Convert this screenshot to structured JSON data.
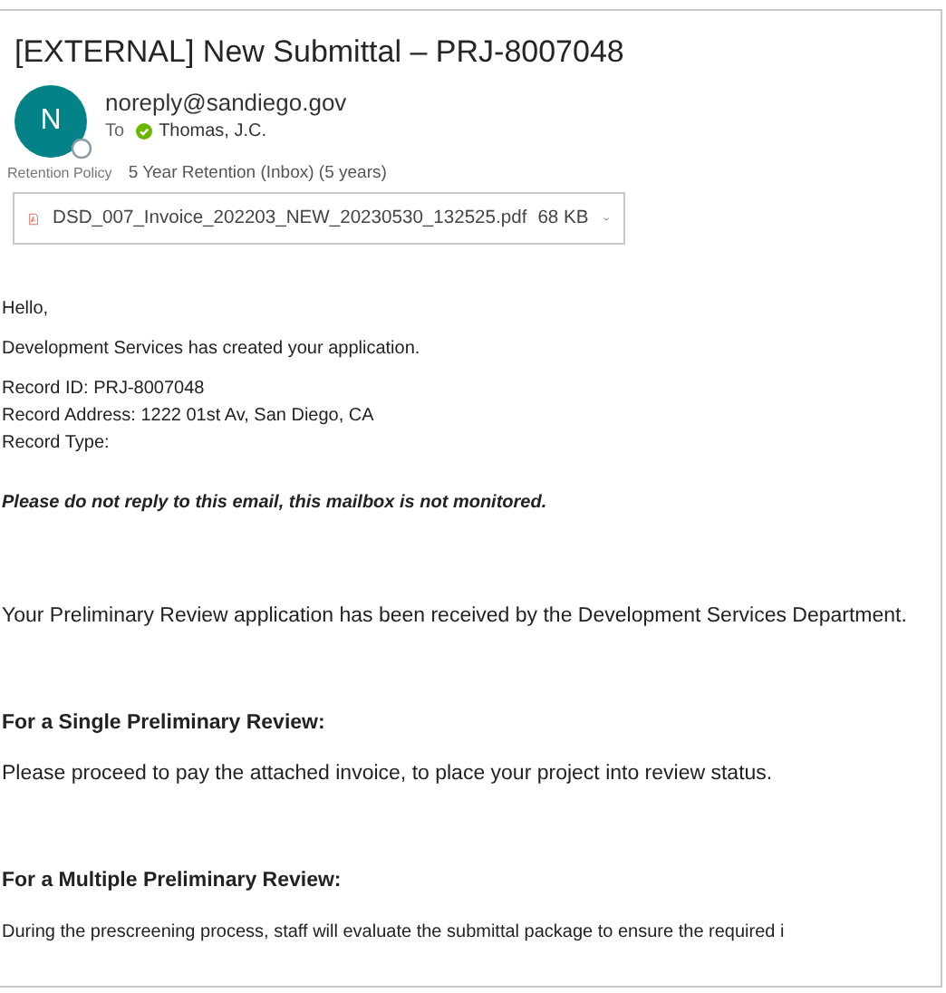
{
  "subject": "[EXTERNAL] New Submittal – PRJ-8007048",
  "sender": {
    "initial": "N",
    "address": "noreply@sandiego.gov"
  },
  "to": {
    "label": "To",
    "name": "Thomas, J.C."
  },
  "retention": {
    "label": "Retention Policy",
    "value": "5 Year Retention (Inbox) (5 years)"
  },
  "attachment": {
    "filename": "DSD_007_Invoice_202203_NEW_20230530_132525.pdf",
    "size": "68 KB"
  },
  "body": [
    {
      "kind": "calibri",
      "lines": [
        "Hello,"
      ]
    },
    {
      "kind": "calibri",
      "lines": [
        "Development Services has created your application."
      ]
    },
    {
      "kind": "arial-tight",
      "lines": [
        "Record ID: PRJ-8007048",
        "Record Address: 1222 01st Av, San Diego, CA",
        "Record Type:"
      ]
    },
    {
      "kind": "notice",
      "lines": [
        "Please do not reply to this email, this mailbox is not monitored."
      ]
    },
    {
      "kind": "arial",
      "lines": [
        "Your Preliminary Review application has been received by the Development Services Department."
      ]
    },
    {
      "kind": "heading",
      "lines": [
        "For a Single Preliminary Review:"
      ]
    },
    {
      "kind": "arial",
      "lines": [
        "Please proceed to pay the attached invoice, to place your project into review status."
      ]
    },
    {
      "kind": "heading",
      "lines": [
        "For a Multiple Preliminary Review:"
      ]
    },
    {
      "kind": "calibri",
      "lines": [
        "During the prescreening process, staff will evaluate the submittal package to ensure the required i"
      ]
    }
  ]
}
